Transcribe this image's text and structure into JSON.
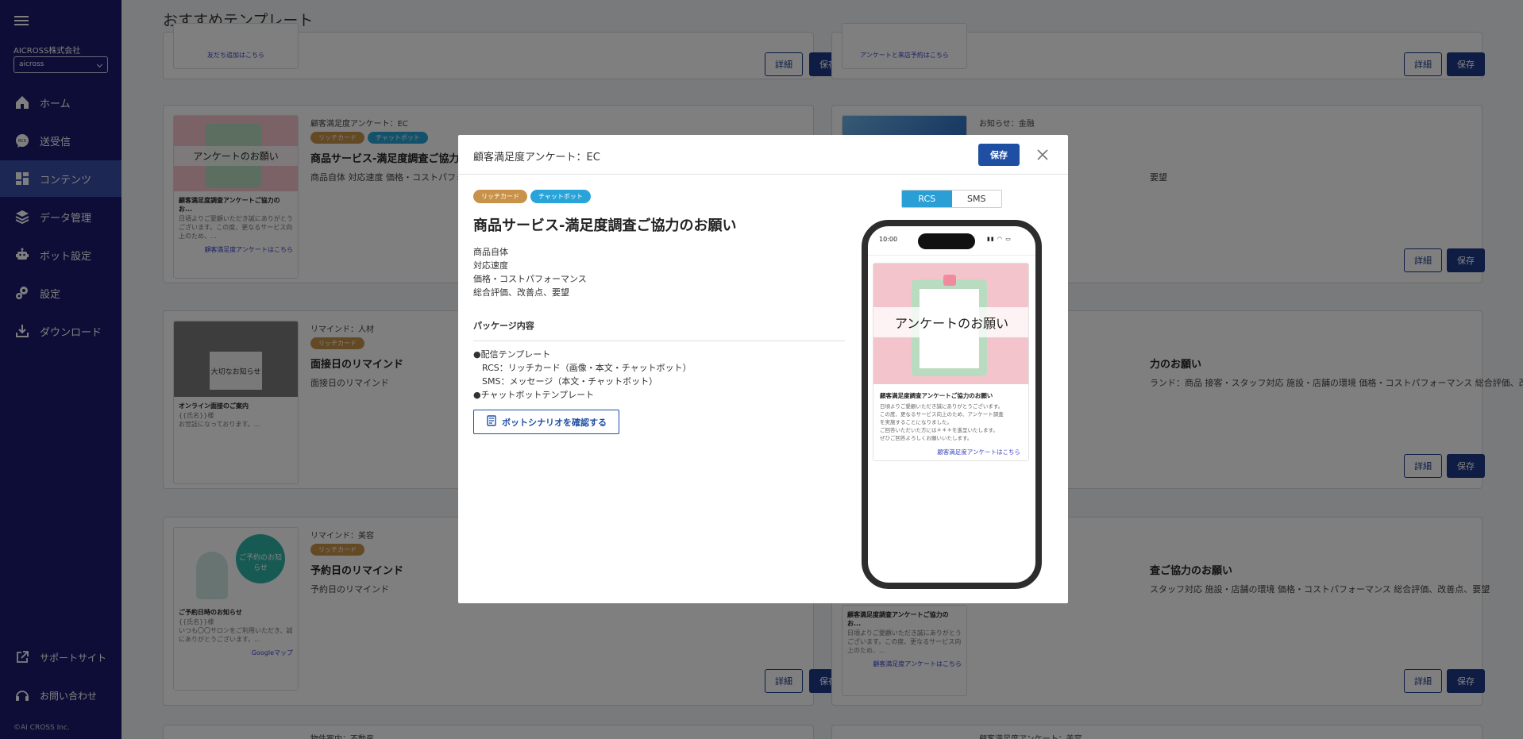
{
  "sidebar": {
    "company": "AICROSS株式会社",
    "tenant": "aicross",
    "items": [
      {
        "label": "ホーム"
      },
      {
        "label": "送受信"
      },
      {
        "label": "コンテンツ"
      },
      {
        "label": "データ管理"
      },
      {
        "label": "ボット設定"
      },
      {
        "label": "設定"
      },
      {
        "label": "ダウンロード"
      }
    ],
    "footer": [
      {
        "label": "サポートサイト"
      },
      {
        "label": "お問い合わせ"
      }
    ],
    "copyright": "©AI CROSS Inc."
  },
  "page": {
    "title": "おすすめテンプレート",
    "detail_label": "詳細",
    "save_label": "保存",
    "cards": [
      {
        "category": "顧客満足度アンケート：EC",
        "tag1": "リッチカード",
        "tag2": "チャットボット",
        "title": "商品サービス-満足度調査ご協力のお願い",
        "desc": "商品自体 対応速度 価格・コストパフォーマンス",
        "thumb_caption": "アンケートのお願い",
        "thumb_title": "顧客満足度調査アンケートご協力のお...",
        "thumb_body": "日頃よりご愛顧いただき誠にありがとうございます。この度、更なるサービス向上のため、...",
        "thumb_link": "顧客満足度アンケートはこちら"
      },
      {
        "category": "リマインド：人材",
        "tag1": "リッチカード",
        "title": "面接日のリマインド",
        "desc": "面接日のリマインド",
        "thumb_caption": "大切なお知らせ",
        "thumb_title": "オンライン面接のご案内",
        "thumb_body": "{{氏名}}様\nお世話になっております。...",
        "thumb_link": ""
      },
      {
        "category": "リマインド：美容",
        "tag1": "リッチカード",
        "title": "予約日のリマインド",
        "desc": "予約日のリマインド",
        "thumb_caption": "ご予約のお知らせ",
        "thumb_title": "ご予約日時のお知らせ",
        "thumb_body": "{{氏名}}様\nいつも〇〇サロンをご利用いただき、誠にありがとうございます。...",
        "thumb_link": "Googleマップ"
      },
      {
        "category": "お知らせ：金融",
        "desc": "要望"
      },
      {
        "title_partial": "力のお願い",
        "desc": "ランド：商品 接客・スタッフ対応 施設・店舗の環境 価格・コストパフォーマンス 総合評価、改善"
      },
      {
        "title_partial": "査ご協力のお願い",
        "desc": "スタッフ対応 施設・店舗の環境 価格・コストパフォーマンス 総合評価、改善点、要望",
        "thumb_title": "顧客満足度調査アンケートご協力のお...",
        "thumb_body": "日頃よりご愛顧いただき誠にありがとうございます。この度、更なるサービス向上のため、...",
        "thumb_link": "顧客満足度アンケートはこちら"
      }
    ],
    "top_links": [
      "友だち追加はこちら",
      "アンケートと来店予約はこちら"
    ],
    "bottom_categories": [
      "物件案内：不動産",
      "顧客満足度アンケート：美容"
    ]
  },
  "modal": {
    "heading": "顧客満足度アンケート：EC",
    "save_label": "保存",
    "tags": [
      "リッチカード",
      "チャットボット"
    ],
    "title": "商品サービス-満足度調査ご協力のお願い",
    "items": [
      "商品自体",
      "対応速度",
      "価格・コストパフォーマンス",
      "総合評価、改善点、要望"
    ],
    "package_heading": "パッケージ内容",
    "package": [
      "●配信テンプレート",
      "RCS：リッチカード（画像・本文・チャットボット）",
      "SMS：メッセージ（本文・チャットボット）",
      "●チャットボットテンプレート"
    ],
    "scenario_button": "ボットシナリオを確認する",
    "toggle": {
      "rcs": "RCS",
      "sms": "SMS"
    },
    "phone": {
      "time": "10:00",
      "image_caption": "アンケートのお願い",
      "title": "顧客満足度調査アンケートご協力のお願い",
      "body": [
        "日頃よりご愛顧いただき誠にありがとうございます。",
        "この度、更なるサービス向上のため、アンケート調査",
        "を実施することになりました。",
        "ご回答いただいた方には＊＊＊を進呈いたします。",
        "ぜひご回答よろしくお願いいたします。"
      ],
      "link": "顧客満足度アンケートはこちら"
    }
  },
  "colors": {
    "sidebar": "#1a1a6e",
    "accent": "#1e4fa3",
    "rich_tag": "#c8924a",
    "bot_tag": "#29a4d9"
  }
}
